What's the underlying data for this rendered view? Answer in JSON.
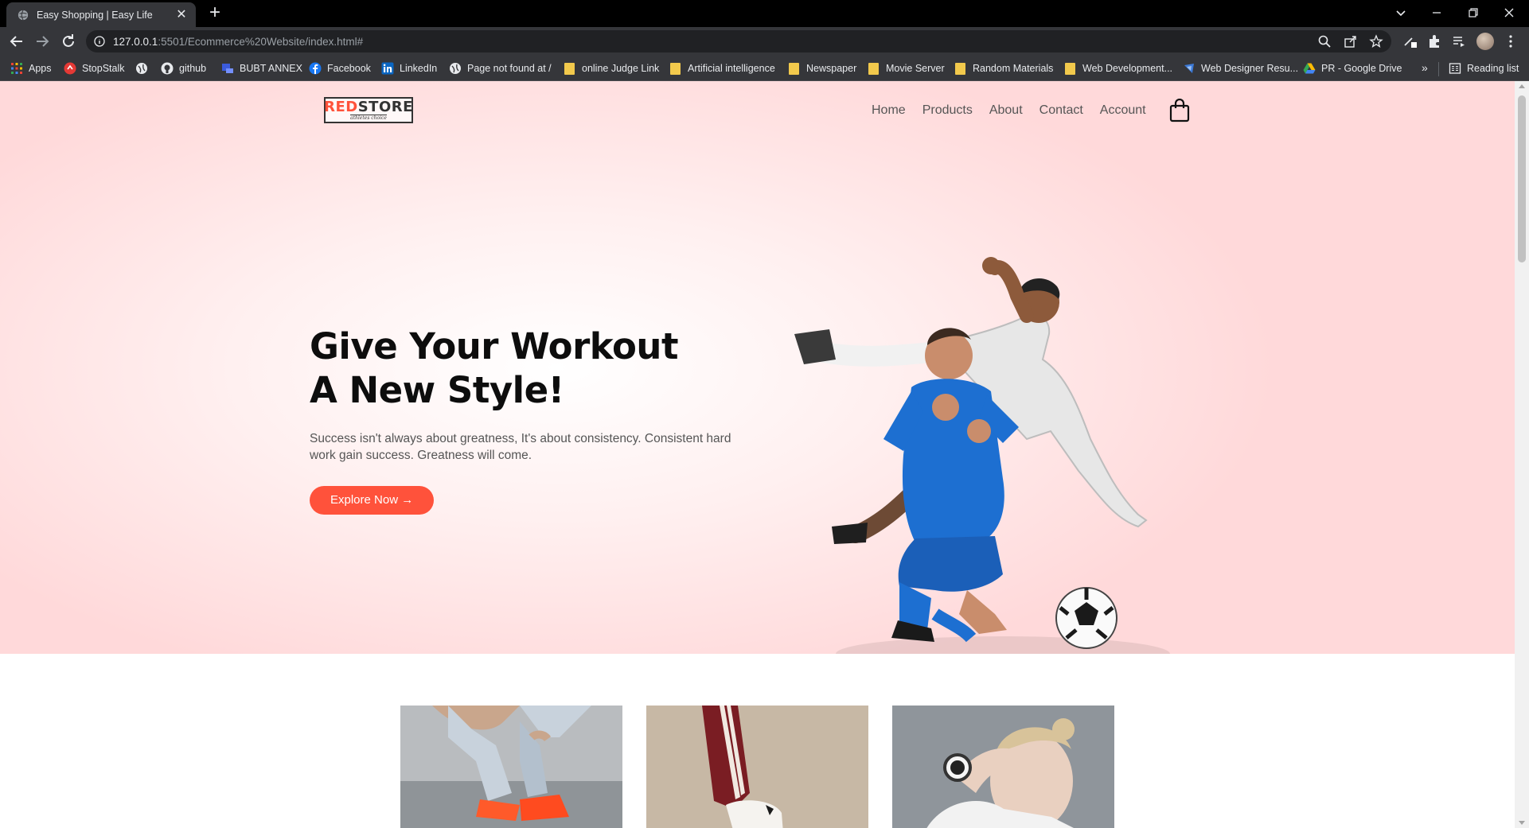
{
  "browser": {
    "tab": {
      "title": "Easy Shopping | Easy Life",
      "close": "✕"
    },
    "new_tab": "+",
    "url_host": "127.0.0.1",
    "url_rest": ":5501/Ecommerce%20Website/index.html#",
    "bookmarks": [
      {
        "label": "Apps",
        "icon": "apps-grid-icon"
      },
      {
        "label": "StopStalk",
        "icon": "stopstalk-icon"
      },
      {
        "label": "",
        "icon": "globe-icon"
      },
      {
        "label": "github",
        "icon": "github-icon"
      },
      {
        "label": "BUBT ANNEX",
        "icon": "bubt-icon"
      },
      {
        "label": "Facebook",
        "icon": "facebook-icon"
      },
      {
        "label": "LinkedIn",
        "icon": "linkedin-icon"
      },
      {
        "label": "Page not found at /",
        "icon": "globe-icon"
      },
      {
        "label": "online Judge Link",
        "icon": "folder-icon"
      },
      {
        "label": "Artificial intelligence",
        "icon": "folder-icon"
      },
      {
        "label": "Newspaper",
        "icon": "folder-icon"
      },
      {
        "label": "Movie Server",
        "icon": "folder-icon"
      },
      {
        "label": "Random Materials",
        "icon": "folder-icon"
      },
      {
        "label": "Web Development...",
        "icon": "folder-icon"
      },
      {
        "label": "Web Designer Resu...",
        "icon": "web-designer-icon"
      },
      {
        "label": "PR - Google Drive",
        "icon": "google-drive-icon"
      }
    ],
    "more_bookmarks": "»",
    "reading_list": "Reading list"
  },
  "site": {
    "logo": {
      "red": "RED",
      "dark": "STORE",
      "tagline": "athletes choice"
    },
    "nav": [
      "Home",
      "Products",
      "About",
      "Contact",
      "Account"
    ],
    "hero": {
      "title_line1": "Give Your Workout",
      "title_line2": "A New Style!",
      "text": "Success isn't always about greatness, It's about consistency. Consistent hard work gain success. Greatness will come.",
      "button": "Explore Now →"
    }
  },
  "colors": {
    "accent": "#ff523b",
    "hero_bg": "#ffd9da"
  }
}
